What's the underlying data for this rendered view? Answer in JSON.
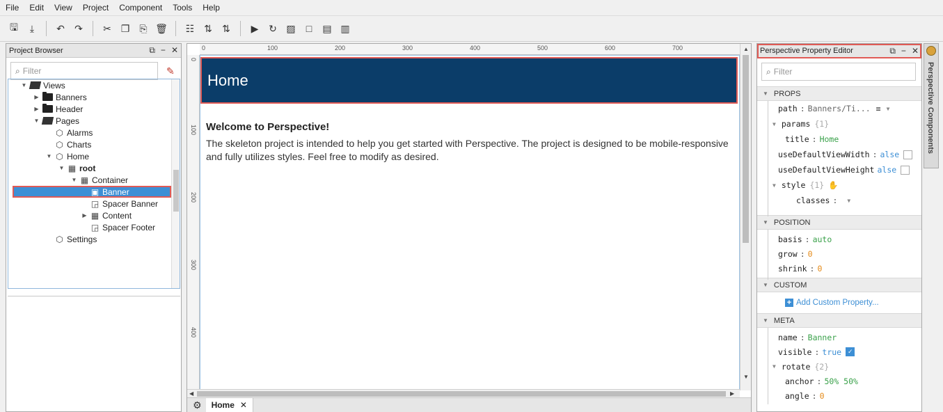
{
  "menu": [
    "File",
    "Edit",
    "View",
    "Project",
    "Component",
    "Tools",
    "Help"
  ],
  "toolbar": {
    "icons": [
      "save-icon",
      "save-all-icon",
      "undo-icon",
      "redo-icon",
      "cut-icon",
      "copy-icon",
      "paste-icon",
      "delete-icon",
      "group-icon",
      "align-icon",
      "play-icon",
      "refresh-icon",
      "layout-icon",
      "window-icon"
    ]
  },
  "project_browser": {
    "title": "Project Browser",
    "filter_placeholder": "Filter",
    "tree": [
      {
        "label": "Views",
        "depth": 0,
        "kind": "folder-open",
        "expanded": true
      },
      {
        "label": "Banners",
        "depth": 1,
        "kind": "folder",
        "expanded": false
      },
      {
        "label": "Header",
        "depth": 1,
        "kind": "folder",
        "expanded": false
      },
      {
        "label": "Pages",
        "depth": 1,
        "kind": "folder-open",
        "expanded": true
      },
      {
        "label": "Alarms",
        "depth": 2,
        "kind": "view"
      },
      {
        "label": "Charts",
        "depth": 2,
        "kind": "view"
      },
      {
        "label": "Home",
        "depth": 2,
        "kind": "view",
        "expanded": true
      },
      {
        "label": "root",
        "depth": 3,
        "kind": "container",
        "bold": true,
        "expanded": true
      },
      {
        "label": "Container",
        "depth": 4,
        "kind": "container",
        "expanded": true
      },
      {
        "label": "Banner",
        "depth": 5,
        "kind": "component",
        "selected": true
      },
      {
        "label": "Spacer Banner",
        "depth": 5,
        "kind": "component"
      },
      {
        "label": "Content",
        "depth": 5,
        "kind": "container",
        "expanded": false
      },
      {
        "label": "Spacer Footer",
        "depth": 5,
        "kind": "component"
      },
      {
        "label": "Settings",
        "depth": 2,
        "kind": "view"
      }
    ]
  },
  "editor": {
    "ruler_h": [
      "0",
      "100",
      "200",
      "300",
      "400",
      "500",
      "600",
      "700"
    ],
    "ruler_v": [
      "0",
      "100",
      "200",
      "300",
      "400"
    ],
    "hero_title": "Home",
    "welcome_heading": "Welcome to Perspective!",
    "welcome_text": "The skeleton project is intended to help you get started with Perspective. The project is designed to be mobile-responsive and fully utilizes styles. Feel free to modify as desired.",
    "tab_label": "Home"
  },
  "property_editor": {
    "title": "Perspective Property Editor",
    "filter_placeholder": "Filter",
    "sections": {
      "props": "PROPS",
      "position": "POSITION",
      "custom": "CUSTOM",
      "meta": "META"
    },
    "props": {
      "path_key": "path",
      "path_val": "Banners/Ti...",
      "params_key": "params",
      "params_count": "{1}",
      "title_key": "title",
      "title_val": "Home",
      "udvw_key": "useDefaultViewWidth",
      "udvw_val": "alse",
      "udvh_key": "useDefaultViewHeight",
      "udvh_val": "alse",
      "style_key": "style",
      "style_count": "{1}",
      "classes_key": "classes"
    },
    "position": {
      "basis_key": "basis",
      "basis_val": "auto",
      "grow_key": "grow",
      "grow_val": "0",
      "shrink_key": "shrink",
      "shrink_val": "0"
    },
    "custom": {
      "add_label": "Add Custom Property..."
    },
    "meta": {
      "name_key": "name",
      "name_val": "Banner",
      "visible_key": "visible",
      "visible_val": "true",
      "rotate_key": "rotate",
      "rotate_count": "{2}",
      "anchor_key": "anchor",
      "anchor_val": "50% 50%",
      "angle_key": "angle",
      "angle_val": "0"
    }
  },
  "side_tab": {
    "label": "Perspective Components"
  },
  "colors": {
    "hero_bg": "#0b3d69",
    "selection": "#3d8fd5",
    "highlight": "#e05a55"
  }
}
